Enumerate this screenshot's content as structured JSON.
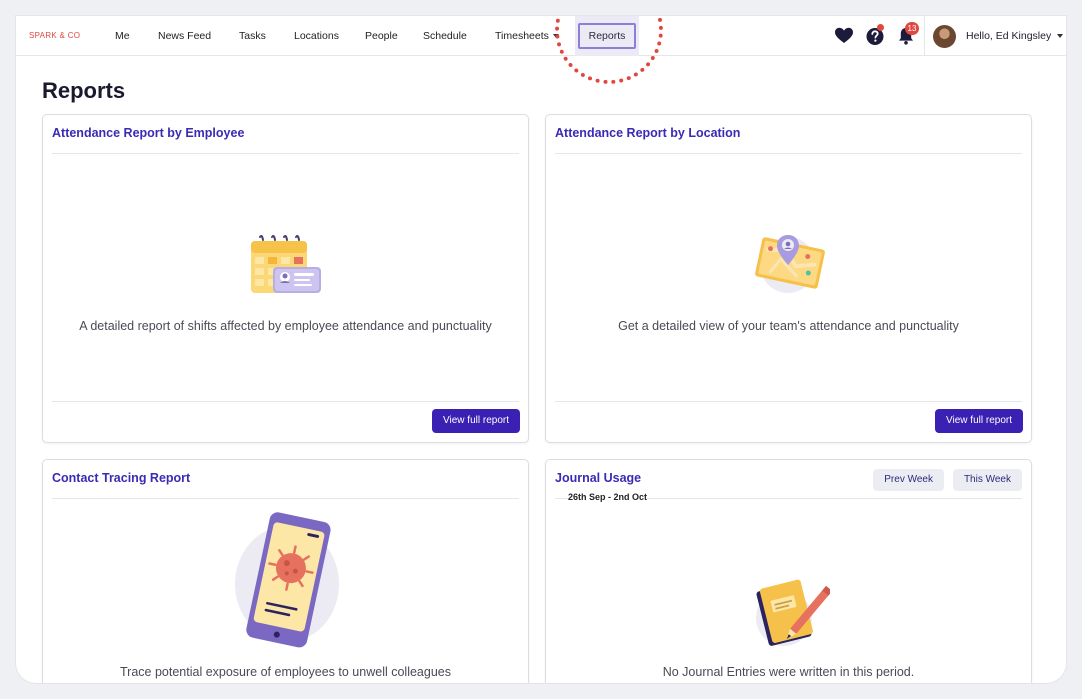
{
  "brand": "SPARK & CO",
  "nav": {
    "items": [
      "Me",
      "News Feed",
      "Tasks",
      "Locations",
      "People",
      "Schedule",
      "Timesheets"
    ],
    "active": "Reports"
  },
  "header": {
    "notifications_count": "13",
    "greeting": "Hello, Ed Kingsley"
  },
  "page": {
    "title": "Reports"
  },
  "cards": {
    "attendance_employee": {
      "title": "Attendance Report by Employee",
      "description": "A detailed report of shifts affected by employee attendance and punctuality",
      "button": "View full report"
    },
    "attendance_location": {
      "title": "Attendance Report by Location",
      "description": "Get a detailed view of your team's attendance and punctuality",
      "button": "View full report"
    },
    "contact_tracing": {
      "title": "Contact Tracing Report",
      "description": "Trace potential exposure of employees to unwell colleagues"
    },
    "journal_usage": {
      "title": "Journal Usage",
      "prev_week": "Prev Week",
      "this_week": "This Week",
      "date_range": "26th Sep - 2nd Oct",
      "empty_message": "No Journal Entries were written in this period."
    }
  },
  "colors": {
    "accent": "#3b20b4",
    "title": "#3a2ab5",
    "brand": "#e0473f",
    "highlight": "#8d7fd8"
  },
  "icons": [
    "heart-icon",
    "help-icon",
    "bell-icon",
    "chevron-down-icon",
    "calendar-id-illustration",
    "map-pin-illustration",
    "virus-phone-illustration",
    "journal-pencil-illustration"
  ]
}
